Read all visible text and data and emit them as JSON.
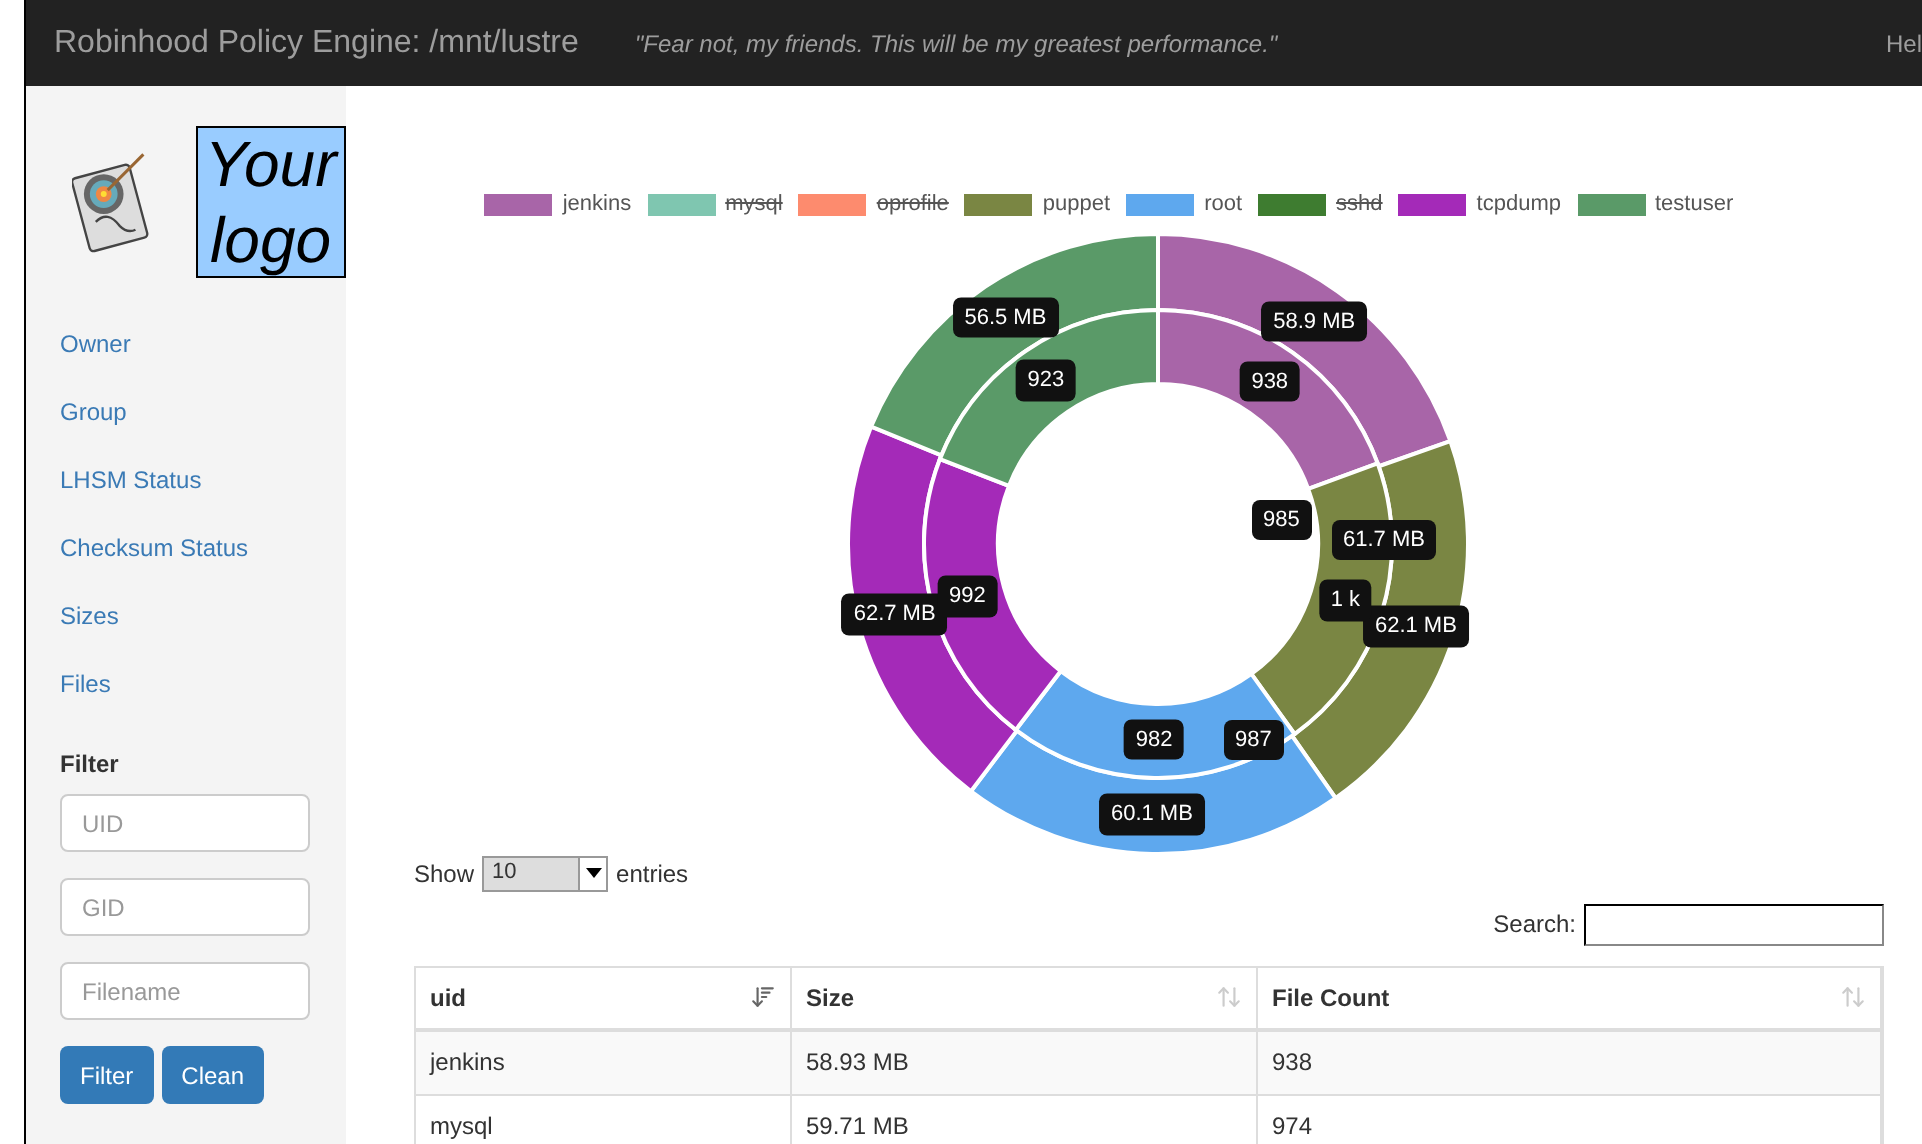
{
  "navbar": {
    "title": "Robinhood Policy Engine: /mnt/lustre",
    "motto": "\"Fear not, my friends. This will be my greatest performance.\"",
    "help": "Hel"
  },
  "sidebar": {
    "logo_text": "Your logo",
    "items": [
      {
        "label": "Owner"
      },
      {
        "label": "Group"
      },
      {
        "label": "LHSM Status"
      },
      {
        "label": "Checksum Status"
      },
      {
        "label": "Sizes"
      },
      {
        "label": "Files"
      }
    ],
    "filter": {
      "title": "Filter",
      "fields": [
        {
          "placeholder": "UID"
        },
        {
          "placeholder": "GID"
        },
        {
          "placeholder": "Filename"
        }
      ],
      "buttons": [
        "Filter",
        "Clean"
      ]
    }
  },
  "chart": {
    "legend_disabled": [
      false,
      true,
      true,
      false,
      false,
      true,
      false,
      false
    ],
    "chart_data": {
      "type": "donut",
      "categories": [
        "jenkins",
        "mysql",
        "oprofile",
        "puppet",
        "root",
        "sshd",
        "tcpdump",
        "testuser"
      ],
      "series": [
        {
          "colors": [
            "#a865a8",
            "#7fc6b0",
            "#fd8b6e",
            "#7a8643",
            "#5ea8ee",
            "#3e7c30",
            "#a42ab8",
            "#5a9a68"
          ],
          "values": [
            58.9,
            null,
            null,
            62.1,
            60.1,
            null,
            62.7,
            56.5
          ],
          "value_labels": [
            "58.9 MB",
            null,
            null,
            "62.1 MB",
            "60.1 MB",
            null,
            "62.7 MB",
            "56.5 MB"
          ]
        },
        {
          "colors": [
            "#a865a8",
            "#7fc6b0",
            "#fd8b6e",
            "#7a8643",
            "#5ea8ee",
            "#3e7c30",
            "#a42ab8",
            "#5a9a68"
          ],
          "values": [
            938,
            null,
            null,
            1000,
            982,
            null,
            992,
            923
          ],
          "value_labels": [
            "938",
            null,
            null,
            "1 k",
            "982",
            null,
            "992",
            "923"
          ]
        }
      ],
      "annotations": [
        "61.7 MB",
        "985",
        "987"
      ]
    }
  },
  "table_controls": {
    "show": "Show",
    "page_size": "10",
    "entries": "entries",
    "search_label": "Search:"
  },
  "table": {
    "columns": [
      {
        "label": "uid",
        "sorted": true
      },
      {
        "label": "Size",
        "sorted": false
      },
      {
        "label": "File Count",
        "sorted": false
      }
    ],
    "rows": [
      [
        "jenkins",
        "58.93 MB",
        "938"
      ],
      [
        "mysql",
        "59.71 MB",
        "974"
      ]
    ]
  }
}
